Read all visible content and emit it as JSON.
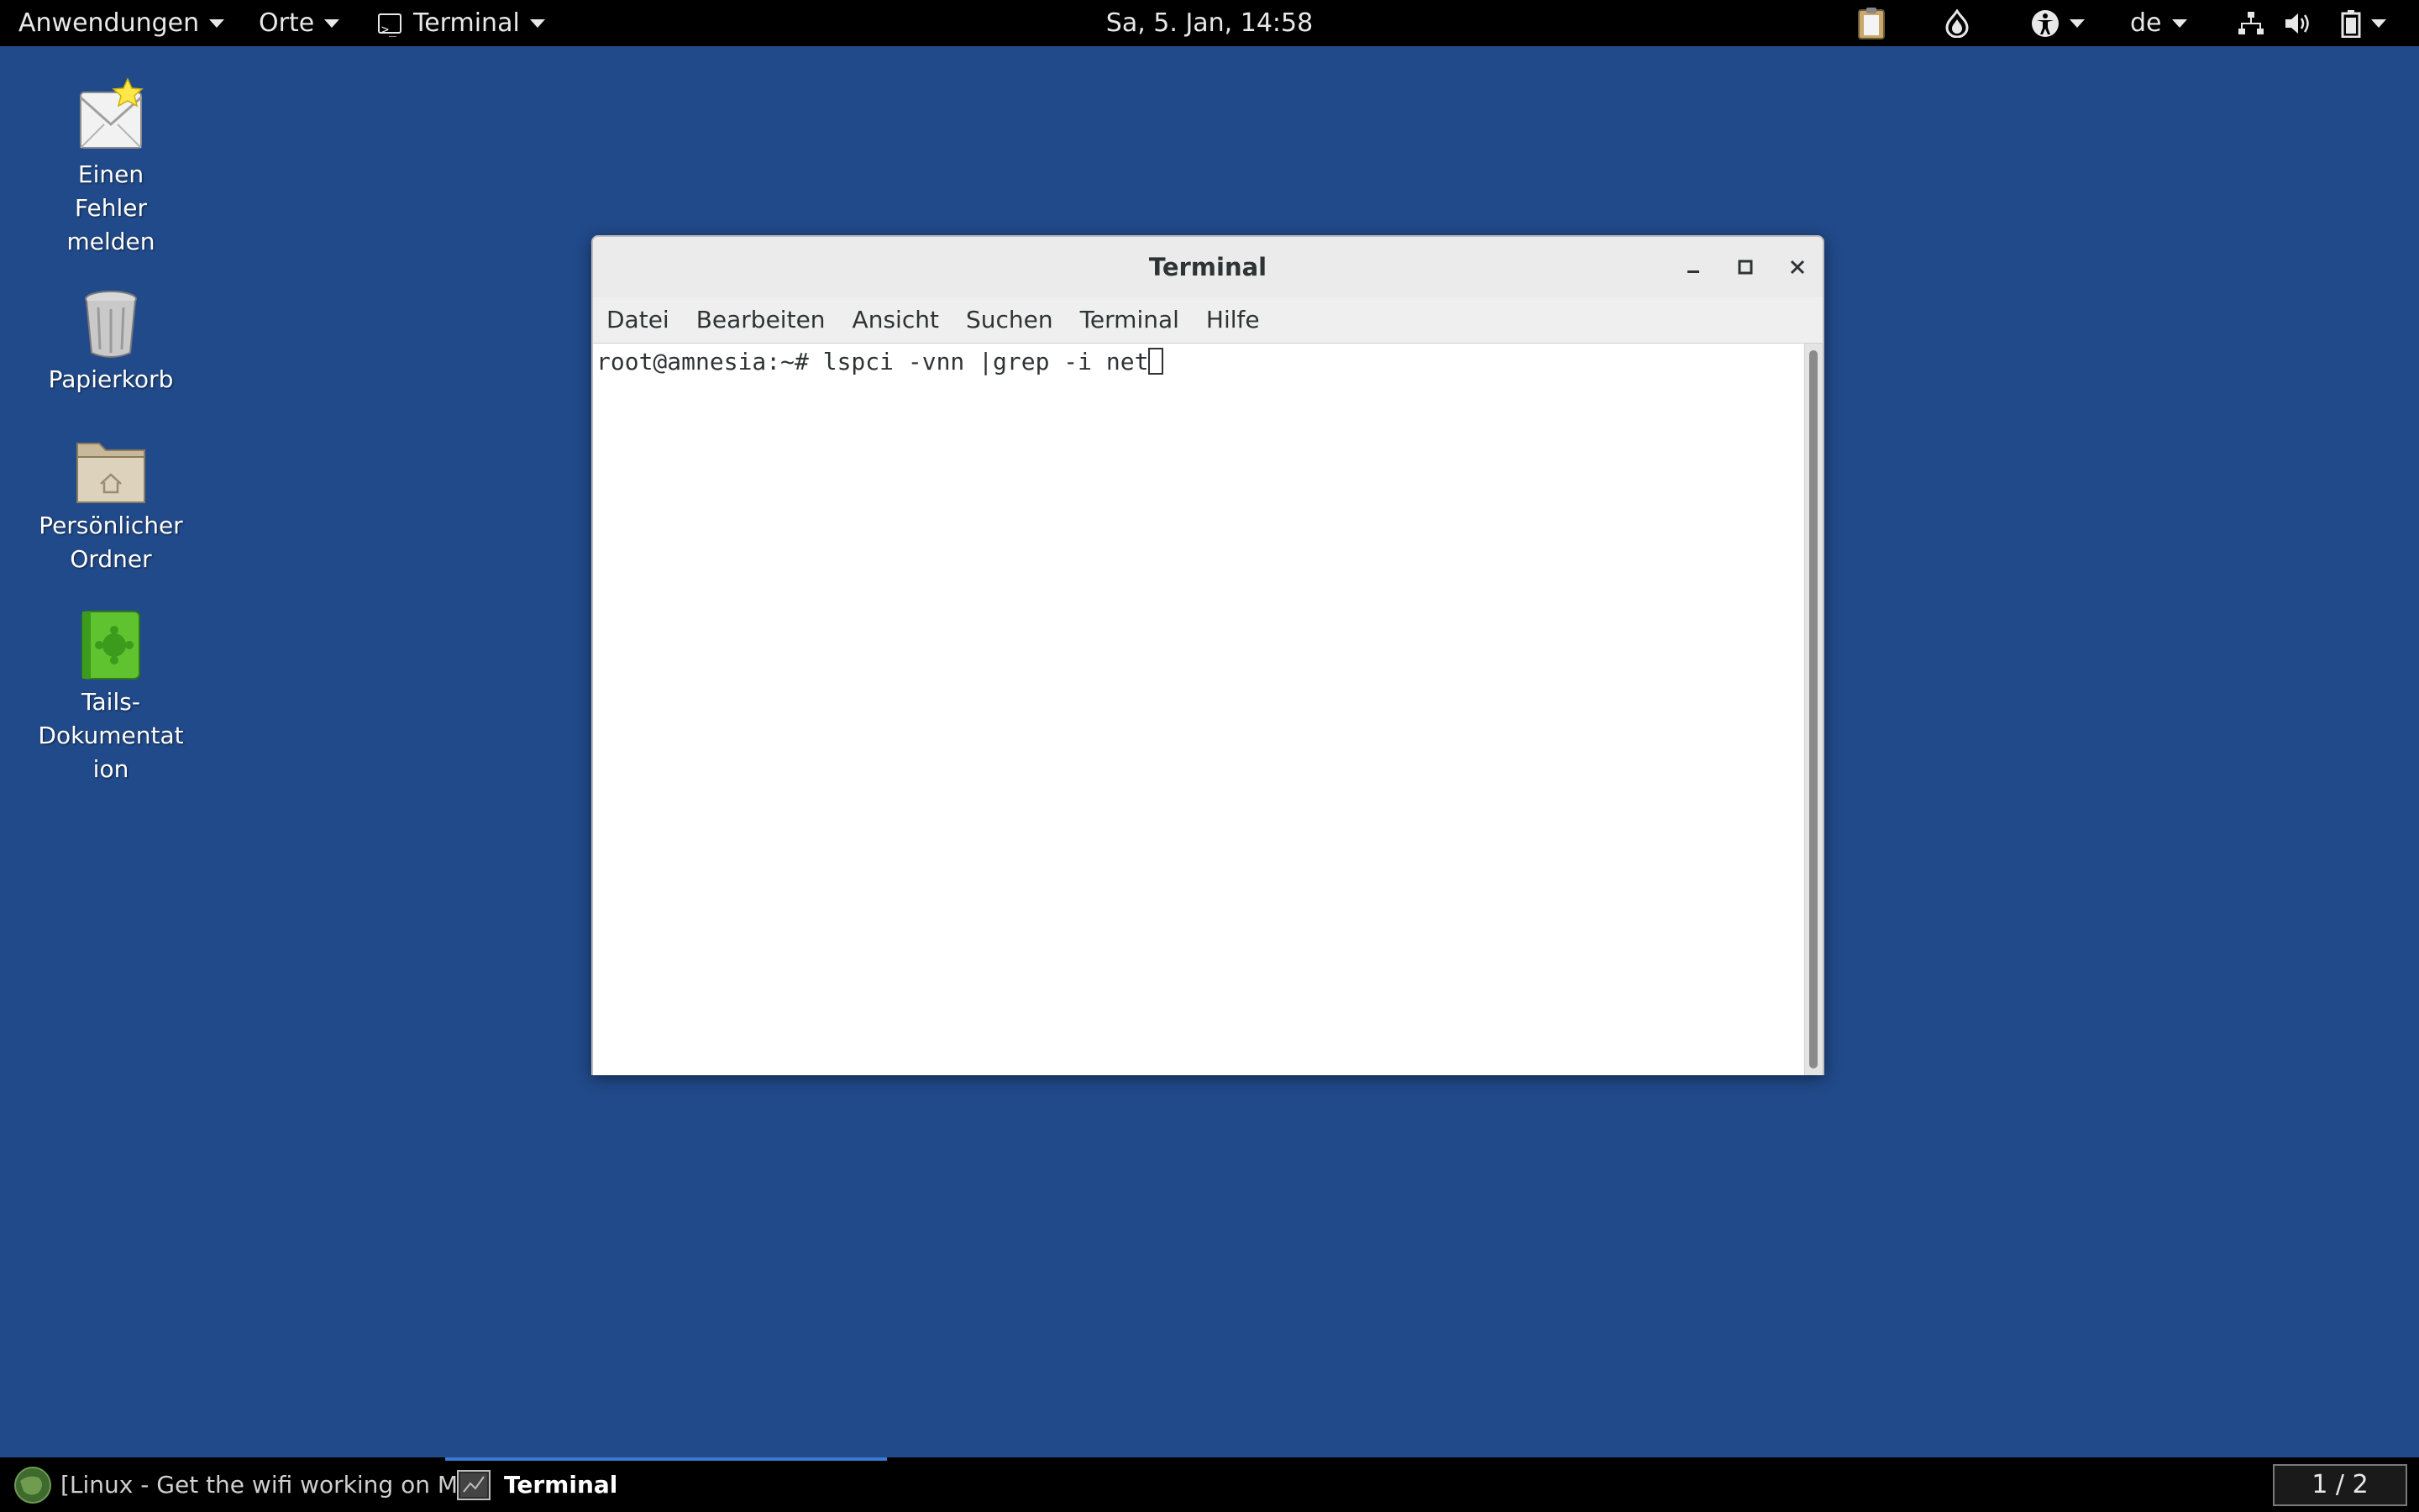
{
  "topbar": {
    "applications_label": "Anwendungen",
    "places_label": "Orte",
    "active_app_label": "Terminal",
    "clock": "Sa,  5. Jan, 14:58",
    "keyboard_layout": "de",
    "icons": [
      "clipboard-icon",
      "onion-circuit-icon",
      "accessibility-icon",
      "network-icon",
      "volume-icon",
      "battery-icon"
    ]
  },
  "desktop": {
    "items": [
      {
        "label_lines": [
          "Einen",
          "Fehler",
          "melden"
        ],
        "icon": "report-bug-icon"
      },
      {
        "label_lines": [
          "Papierkorb"
        ],
        "icon": "trash-icon"
      },
      {
        "label_lines": [
          "Persönlicher",
          "Ordner"
        ],
        "icon": "home-folder-icon"
      },
      {
        "label_lines": [
          "Tails-",
          "Dokumentat",
          "ion"
        ],
        "icon": "tails-docs-icon"
      }
    ]
  },
  "window": {
    "title": "Terminal",
    "menu": [
      "Datei",
      "Bearbeiten",
      "Ansicht",
      "Suchen",
      "Terminal",
      "Hilfe"
    ],
    "prompt": "root@amnesia:~# ",
    "command": "lspci -vnn |grep -i net"
  },
  "taskbar": {
    "tasks": [
      {
        "label": "[Linux - Get the wifi working on M...",
        "active": false
      },
      {
        "label": "Terminal",
        "active": true
      }
    ],
    "workspace": "1 / 2"
  },
  "colors": {
    "desktop_bg": "#214a8a",
    "panel_bg": "#000000",
    "task_indicator": "#3b79d2"
  }
}
